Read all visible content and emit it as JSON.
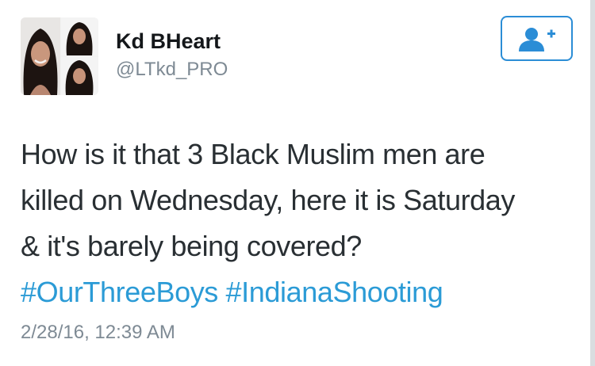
{
  "user": {
    "display_name": "Kd BHeart",
    "handle": "@LTkd_PRO",
    "avatar_icon": "profile-photo-collage"
  },
  "follow_button": {
    "icon": "add-user-icon",
    "color": "#2b8dd6"
  },
  "tweet": {
    "text_line_1": "How is it that 3 Black Muslim men are",
    "text_line_2": "killed on Wednesday, here it is Saturday",
    "text_line_3": "& it's barely being covered?",
    "hashtags": [
      "#OurThreeBoys",
      "#IndianaShooting"
    ],
    "hashtag_color": "#2b9bd6"
  },
  "timestamp": "2/28/16, 12:39 AM"
}
